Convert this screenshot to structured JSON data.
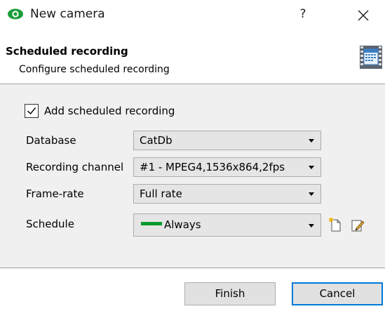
{
  "window": {
    "title": "New camera",
    "help_label": "?",
    "close_label": "✕",
    "app_icon": "eye-icon",
    "app_icon_color": "#1a9e3a"
  },
  "header": {
    "title": "Scheduled recording",
    "subtitle": "Configure scheduled recording",
    "icon": "calendar-film-icon"
  },
  "form": {
    "add_scheduled_recording": {
      "label": "Add scheduled recording",
      "checked": true
    },
    "database": {
      "label": "Database",
      "value": "CatDb"
    },
    "recording_channel": {
      "label": "Recording channel",
      "value": "#1 - MPEG4,1536x864,2fps"
    },
    "frame_rate": {
      "label": "Frame-rate",
      "value": "Full rate"
    },
    "schedule": {
      "label": "Schedule",
      "value": "Always",
      "swatch_color": "#0a9b2f",
      "new_icon": "new-document-icon",
      "edit_icon": "edit-pencil-icon"
    }
  },
  "footer": {
    "finish_label": "Finish",
    "cancel_label": "Cancel",
    "default_button_border": "#0078d7"
  }
}
